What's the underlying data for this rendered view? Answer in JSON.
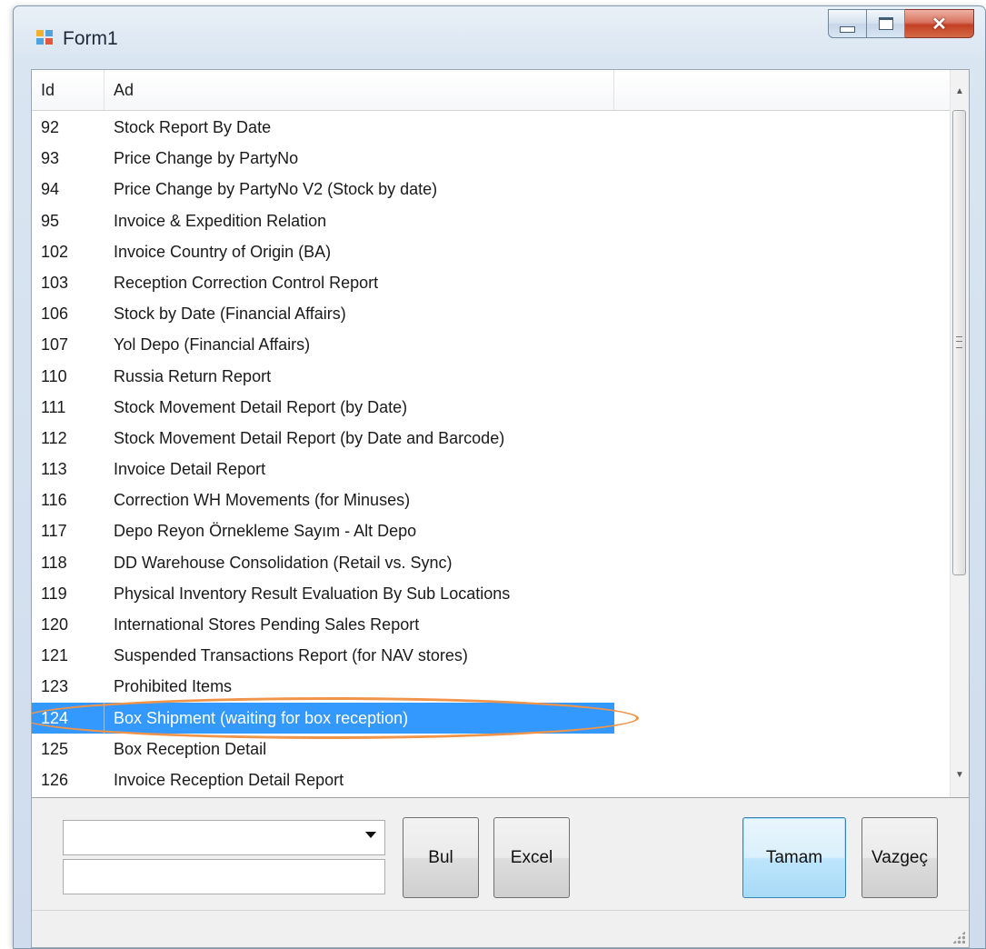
{
  "window": {
    "title": "Form1"
  },
  "list": {
    "columns": {
      "id": "Id",
      "ad": "Ad"
    },
    "rows": [
      {
        "id": "92",
        "ad": "Stock Report By Date"
      },
      {
        "id": "93",
        "ad": "Price Change by PartyNo"
      },
      {
        "id": "94",
        "ad": "Price Change by PartyNo  V2 (Stock by date)"
      },
      {
        "id": "95",
        "ad": "Invoice & Expedition Relation"
      },
      {
        "id": "102",
        "ad": "Invoice Country of Origin (BA)"
      },
      {
        "id": "103",
        "ad": "Reception Correction Control Report"
      },
      {
        "id": "106",
        "ad": "Stock by Date (Financial Affairs)"
      },
      {
        "id": "107",
        "ad": "Yol Depo (Financial Affairs)"
      },
      {
        "id": "110",
        "ad": "Russia Return Report"
      },
      {
        "id": "111",
        "ad": "Stock Movement Detail Report (by Date)"
      },
      {
        "id": "112",
        "ad": "Stock Movement Detail Report (by Date and Barcode)"
      },
      {
        "id": "113",
        "ad": "Invoice Detail Report"
      },
      {
        "id": "116",
        "ad": "Correction WH Movements (for Minuses)"
      },
      {
        "id": "117",
        "ad": "Depo Reyon Örnekleme Sayım - Alt Depo"
      },
      {
        "id": "118",
        "ad": "DD Warehouse Consolidation (Retail vs. Sync)"
      },
      {
        "id": "119",
        "ad": "Physical Inventory Result Evaluation By Sub Locations"
      },
      {
        "id": "120",
        "ad": "International Stores Pending Sales Report"
      },
      {
        "id": "121",
        "ad": "Suspended Transactions Report (for NAV stores)"
      },
      {
        "id": "123",
        "ad": "Prohibited Items"
      },
      {
        "id": "124",
        "ad": "Box Shipment (waiting for box reception)",
        "selected": true
      },
      {
        "id": "125",
        "ad": "Box Reception Detail"
      },
      {
        "id": "126",
        "ad": "Invoice Reception Detail Report"
      }
    ]
  },
  "controls": {
    "combo_value": "",
    "search_value": "",
    "bul_label": "Bul",
    "excel_label": "Excel",
    "tamam_label": "Tamam",
    "vazgec_label": "Vazgeç"
  },
  "colors": {
    "selection": "#3399ff",
    "annotation_ring": "#f0944a"
  }
}
